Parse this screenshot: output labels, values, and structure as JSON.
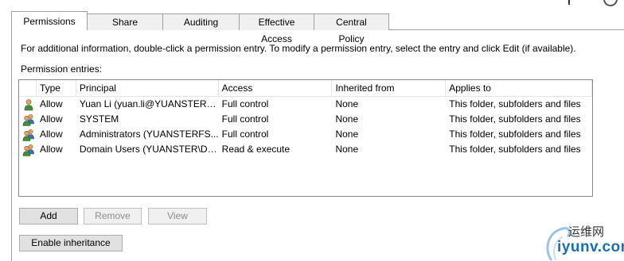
{
  "tabs": [
    {
      "label": "Permissions",
      "active": true
    },
    {
      "label": "Share",
      "active": false
    },
    {
      "label": "Auditing",
      "active": false
    },
    {
      "label": "Effective Access",
      "active": false
    },
    {
      "label": "Central Policy",
      "active": false
    }
  ],
  "info_text": "For additional information, double-click a permission entry. To modify a permission entry, select the entry and click Edit (if available).",
  "entries_label": "Permission entries:",
  "columns": {
    "type": "Type",
    "principal": "Principal",
    "access": "Access",
    "inherited_from": "Inherited from",
    "applies_to": "Applies to"
  },
  "entries": [
    {
      "icon": "user-icon",
      "type": "Allow",
      "principal": "Yuan Li (yuan.li@YUANSTER.l...",
      "access": "Full control",
      "inherited_from": "None",
      "applies_to": "This folder, subfolders and files"
    },
    {
      "icon": "group-icon",
      "type": "Allow",
      "principal": "SYSTEM",
      "access": "Full control",
      "inherited_from": "None",
      "applies_to": "This folder, subfolders and files"
    },
    {
      "icon": "group-icon",
      "type": "Allow",
      "principal": "Administrators (YUANSTERFS...",
      "access": "Full control",
      "inherited_from": "None",
      "applies_to": "This folder, subfolders and files"
    },
    {
      "icon": "group-icon",
      "type": "Allow",
      "principal": "Domain Users (YUANSTER\\Do...",
      "access": "Read & execute",
      "inherited_from": "None",
      "applies_to": "This folder, subfolders and files"
    }
  ],
  "buttons": {
    "add": "Add",
    "remove": "Remove",
    "view": "View",
    "enable_inheritance": "Enable inheritance"
  },
  "watermark": {
    "cn": "运维网",
    "en": "iyunv.com"
  }
}
